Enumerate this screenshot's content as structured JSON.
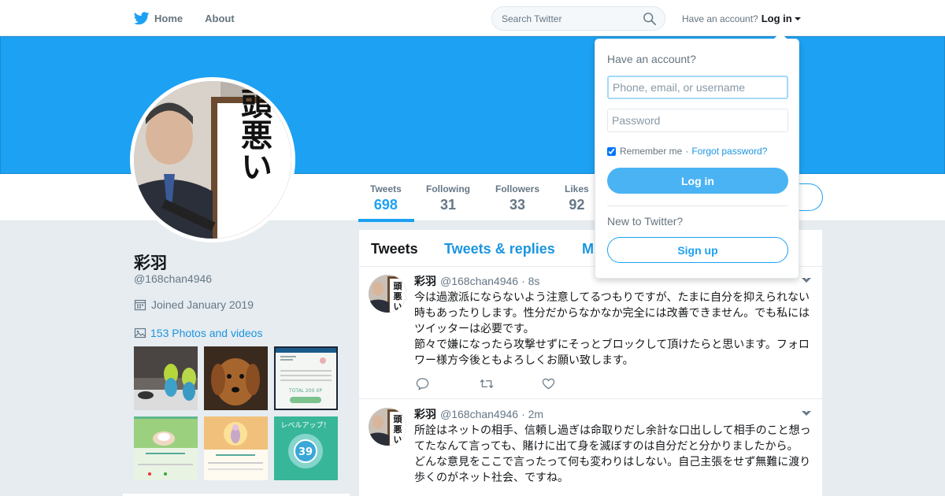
{
  "nav": {
    "home_label": "Home",
    "about_label": "About",
    "search_placeholder": "Search Twitter",
    "have_account_text": "Have an account?",
    "login_label": "Log in"
  },
  "profile": {
    "name": "彩羽",
    "handle": "@168chan4946",
    "joined": "Joined January 2019",
    "photos_link": "153 Photos and videos",
    "avatar_sign_text": "頭悪い",
    "thumbnails": [
      {
        "label": "budgies photo"
      },
      {
        "label": "dachshund photo"
      },
      {
        "label": "game screen",
        "text": "TOTAL 200 XP"
      },
      {
        "label": "game screen"
      },
      {
        "label": "game screen"
      },
      {
        "label": "game level up screen",
        "text": "レベルアップ！",
        "level": "39"
      }
    ]
  },
  "stats": [
    {
      "label": "Tweets",
      "value": "698",
      "active": true
    },
    {
      "label": "Following",
      "value": "31",
      "active": false
    },
    {
      "label": "Followers",
      "value": "33",
      "active": false
    },
    {
      "label": "Likes",
      "value": "92",
      "active": false
    }
  ],
  "timeline": {
    "tabs": [
      {
        "label": "Tweets",
        "active": true
      },
      {
        "label": "Tweets & replies",
        "active": false
      },
      {
        "label": "M",
        "active": false
      }
    ],
    "tweets": [
      {
        "name": "彩羽",
        "handle": "@168chan4946",
        "time": "· 8s",
        "text": "今は過激派にならないよう注意してるつもりですが、たまに自分を抑えられない時もあったりします。性分だからなかなか完全には改善できません。でも私にはツイッターは必要です。\n節々で嫌になったら攻撃せずにそっとブロックして頂けたらと思います。フォロワー様方今後ともよろしくお願い致します。"
      },
      {
        "name": "彩羽",
        "handle": "@168chan4946",
        "time": "· 2m",
        "text": "所詮はネットの相手、信頼し過ぎは命取りだし余計な口出しして相手のこと想ってたなんて言っても、賭けに出て身を滅ぼすのは自分だと分かりましたから。\nどんな意見をここで言ったって何も変わりはしない。自己主張をせず無難に渡り歩くのがネット社会、ですね。"
      }
    ]
  },
  "login_dropdown": {
    "title": "Have an account?",
    "username_placeholder": "Phone, email, or username",
    "password_placeholder": "Password",
    "remember_label": "Remember me",
    "separator": "·",
    "forgot_label": "Forgot password?",
    "login_button": "Log in",
    "new_label": "New to Twitter?",
    "signup_button": "Sign up",
    "remember_checked": true
  },
  "colors": {
    "brand_blue": "#1da1f2",
    "link_blue": "#1b95e0",
    "background": "#e6ecf0"
  }
}
